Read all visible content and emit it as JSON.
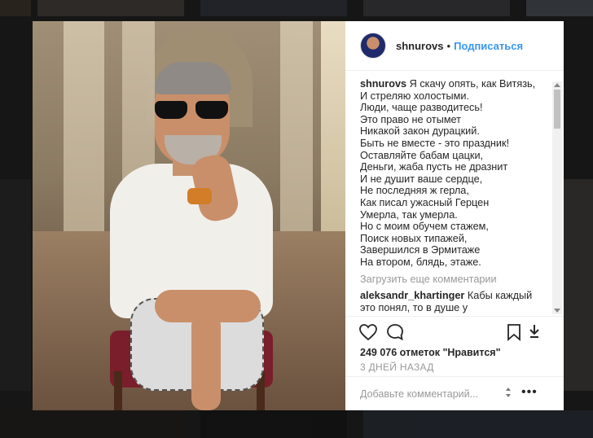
{
  "post": {
    "username": "shnurovs",
    "separator": "•",
    "follow_label": "Подписаться",
    "caption": {
      "username": "shnurovs",
      "text": "Я скачу опять, как Витязь,\nИ стреляю холостыми.\nЛюди, чаще разводитесь!\nЭто право не отымет\nНикакой закон дурацкий.\nБыть не вместе - это праздник!\nОставляйте бабам цацки,\nДеньги, жаба пусть не дразнит\nИ не душит ваше сердце,\nНе последняя ж герла,\nКак писал ужасный Герцен\nУмерла, так умерла.\nНо с моим обучем стажем,\nПоиск новых типажей,\nЗавершился в Эрмитаже\nНа втором, блядь, этаже."
    },
    "load_more_label": "Загрузить еще комментарии",
    "comments": [
      {
        "username": "aleksandr_khartinger",
        "text": "Кабы каждый это понял, то в душе у"
      }
    ],
    "likes_text": "249 076 отметок \"Нравится\"",
    "time_ago": "3 ДНЕЙ НАЗАД",
    "comment_placeholder": "Добавьте комментарий...",
    "more_label": "•••"
  },
  "icons": {
    "like": "heart-icon",
    "comment": "comment-bubble-icon",
    "save": "bookmark-icon",
    "download": "download-icon"
  },
  "colors": {
    "accent": "#3897f0",
    "muted": "#999999",
    "text": "#262626"
  }
}
